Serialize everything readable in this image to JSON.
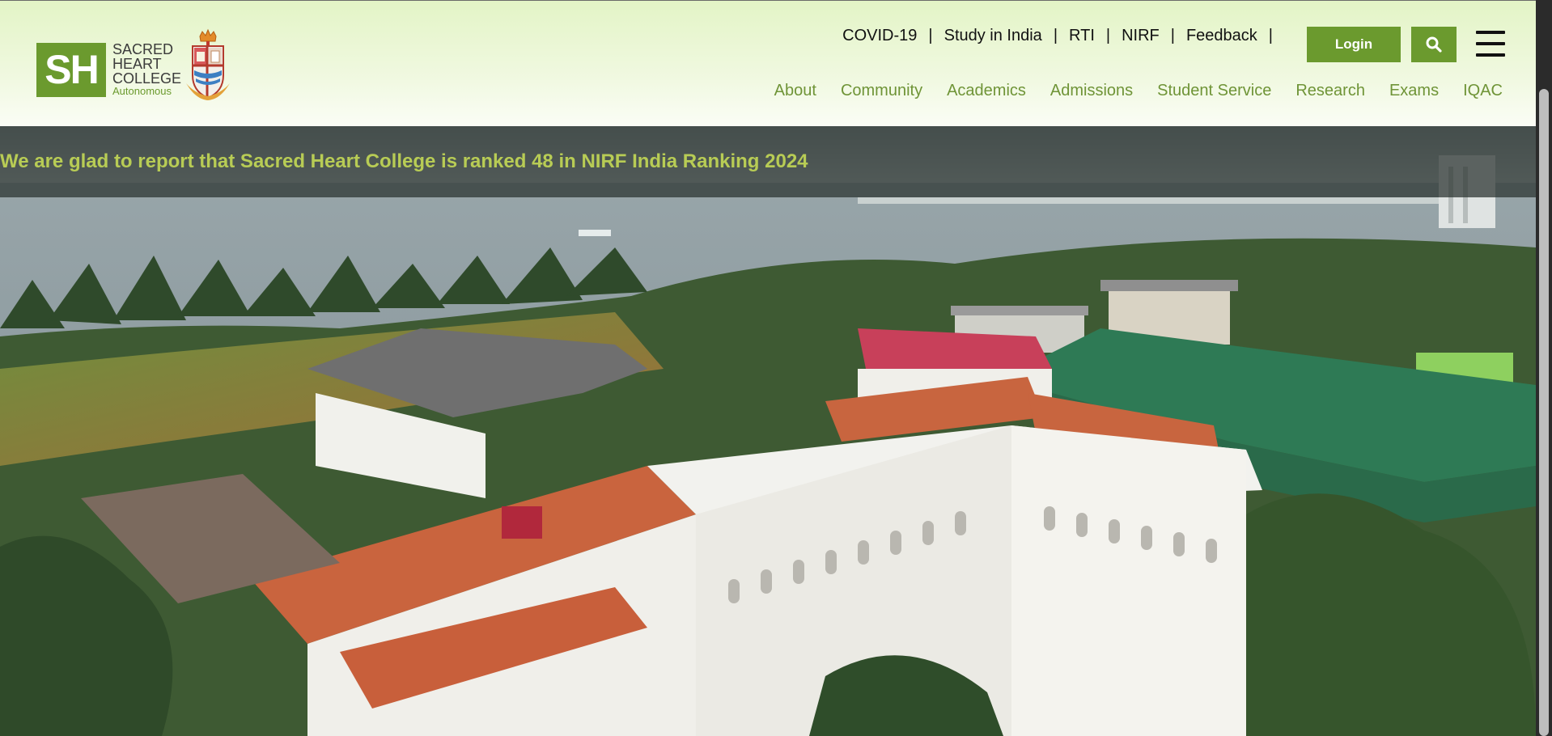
{
  "brand": {
    "mark": "SH",
    "line1": "SACRED",
    "line2": "HEART",
    "line3": "COLLEGE",
    "sub": "Autonomous",
    "accent": "#6b9a2e"
  },
  "top_links": [
    "COVID-19",
    "Study in India",
    "RTI",
    "NIRF",
    "Feedback"
  ],
  "login_label": "Login",
  "main_nav": [
    "About",
    "Community",
    "Academics",
    "Admissions",
    "Student Service",
    "Research",
    "Exams",
    "IQAC"
  ],
  "announcement": "We are glad to report that Sacred Heart College is ranked 48 in NIRF India Ranking 2024",
  "icons": {
    "search": "search-icon",
    "menu": "hamburger-menu-icon"
  }
}
